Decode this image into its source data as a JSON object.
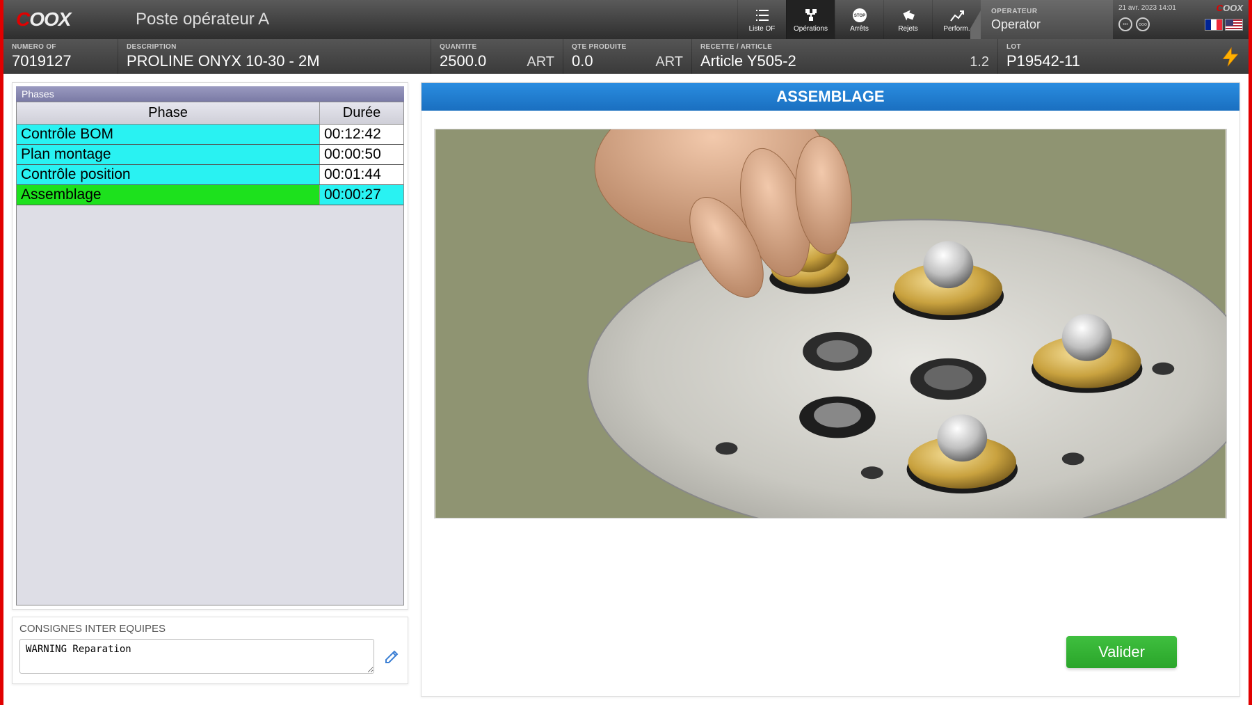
{
  "header": {
    "brand": "COOX",
    "page_title": "Poste opérateur A",
    "nav": [
      {
        "id": "liste-of",
        "label": "Liste OF"
      },
      {
        "id": "operations",
        "label": "Opérations"
      },
      {
        "id": "arrets",
        "label": "Arrêts"
      },
      {
        "id": "rejets",
        "label": "Rejets"
      },
      {
        "id": "perform",
        "label": "Perform."
      }
    ],
    "active_nav": "operations",
    "user_role_label": "OPERATEUR",
    "user_name": "Operator",
    "datetime": "21 avr. 2023 14:01"
  },
  "info": {
    "numero_label": "NUMERO OF",
    "numero_value": "7019127",
    "description_label": "DESCRIPTION",
    "description_value": "PROLINE ONYX 10-30 - 2M",
    "quantite_label": "QUANTITE",
    "quantite_value": "2500.0",
    "quantite_unit": "ART",
    "qte_prod_label": "QTE PRODUITE",
    "qte_prod_value": "0.0",
    "qte_prod_unit": "ART",
    "recette_label": "RECETTE / ARTICLE",
    "recette_value": "Article Y505-2",
    "recette_version": "1.2",
    "lot_label": "LOT",
    "lot_value": "P19542-11"
  },
  "phases": {
    "panel_title": "Phases",
    "col_phase": "Phase",
    "col_duration": "Durée",
    "rows": [
      {
        "name": "Contrôle BOM",
        "duration": "00:12:42",
        "state": "done"
      },
      {
        "name": "Plan montage",
        "duration": "00:00:50",
        "state": "done"
      },
      {
        "name": "Contrôle position",
        "duration": "00:01:44",
        "state": "done"
      },
      {
        "name": "Assemblage",
        "duration": "00:00:27",
        "state": "active"
      }
    ]
  },
  "consignes": {
    "label": "CONSIGNES INTER EQUIPES",
    "value": "WARNING Reparation"
  },
  "operation": {
    "title": "ASSEMBLAGE",
    "validate_label": "Valider"
  }
}
